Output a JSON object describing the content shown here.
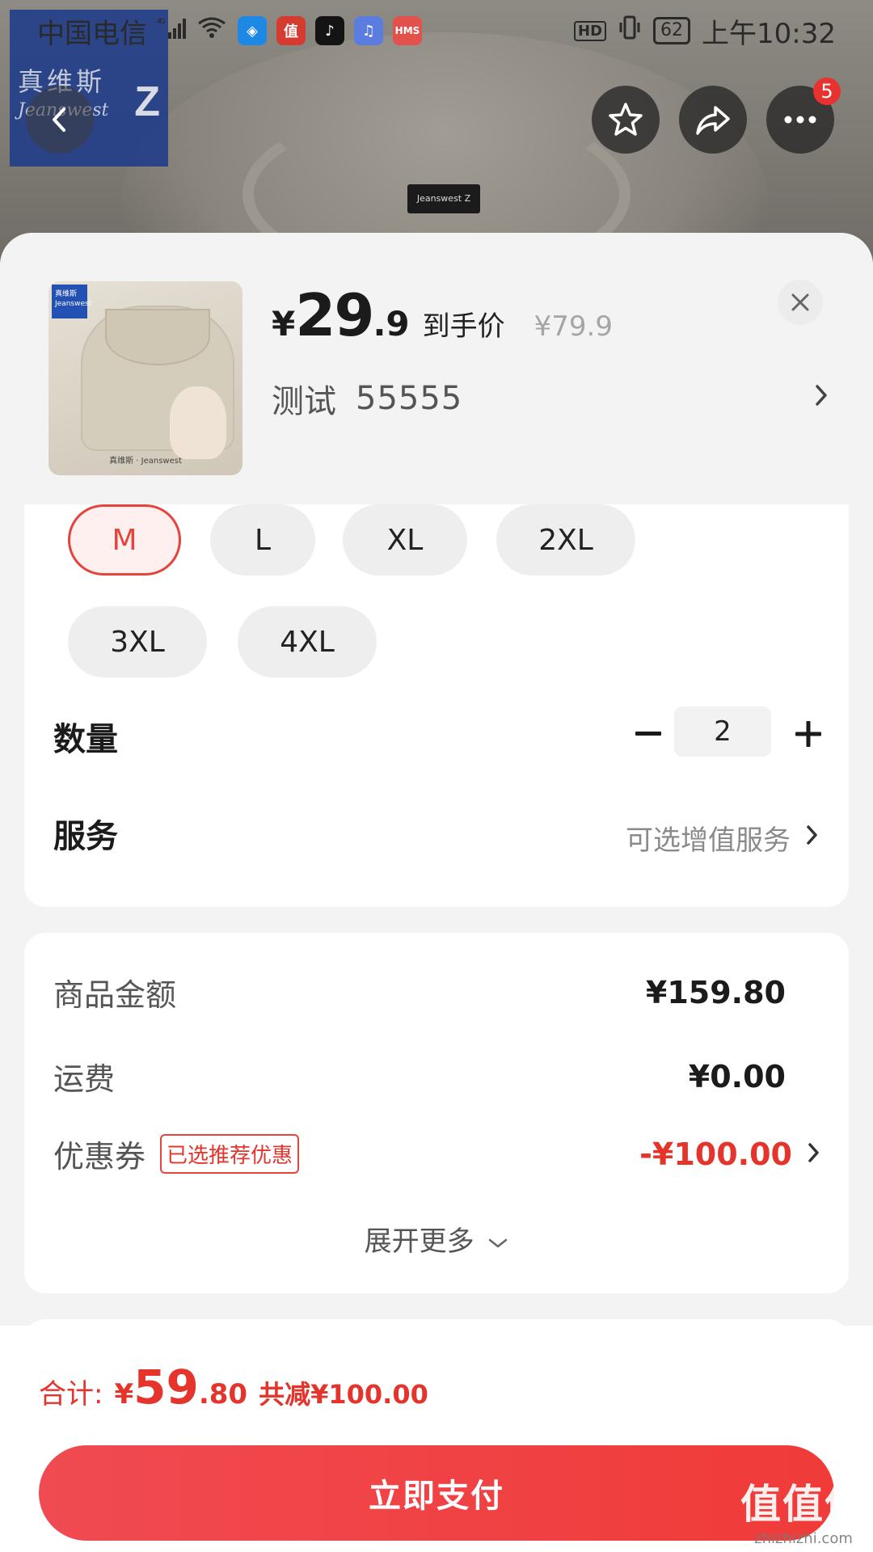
{
  "status_bar": {
    "carrier": "中国电信",
    "signal": "4G",
    "time": "上午10:32",
    "hd": "HD",
    "battery": "62",
    "apps": [
      {
        "name": "compass-app",
        "color": "#1e88e5",
        "glyph": "◈"
      },
      {
        "name": "zhi-app",
        "color": "#d63b2f",
        "glyph": "值"
      },
      {
        "name": "tiktok-app",
        "color": "#141414",
        "glyph": "♪"
      },
      {
        "name": "music-app",
        "color": "#5b7de0",
        "glyph": "♫"
      },
      {
        "name": "hms-app",
        "color": "#e2514c",
        "glyph": "HMS"
      }
    ]
  },
  "background": {
    "brand_cn": "真维斯",
    "brand_en": "Jeanswest",
    "brand_mark": "Z",
    "tag_text": "Jeanswest Z"
  },
  "nav": {
    "more_badge": "5"
  },
  "product": {
    "price_yen": "¥",
    "price_int": "29",
    "price_dec": ".9",
    "price_tag": "到手价",
    "original_price": "¥79.9",
    "spec_label": "测试",
    "spec_value": "55555",
    "thumb_logo": "真维斯 Jeanswest",
    "thumb_caption": "真维斯 · Jeanswest"
  },
  "sizes": [
    {
      "label": "M",
      "selected": true
    },
    {
      "label": "L",
      "selected": false
    },
    {
      "label": "XL",
      "selected": false
    },
    {
      "label": "2XL",
      "selected": false
    },
    {
      "label": "3XL",
      "selected": false
    },
    {
      "label": "4XL",
      "selected": false
    }
  ],
  "quantity": {
    "label": "数量",
    "value": "2",
    "minus": "−",
    "plus": "+"
  },
  "service": {
    "label": "服务",
    "hint": "可选增值服务"
  },
  "summary": {
    "goods_label": "商品金额",
    "goods_value": "¥159.80",
    "shipping_label": "运费",
    "shipping_value": "¥0.00",
    "coupon_label": "优惠券",
    "coupon_tag": "已选推荐优惠",
    "coupon_value": "-¥100.00",
    "expand_label": "展开更多"
  },
  "bottom": {
    "total_label": "合计:",
    "total_yen": "¥",
    "total_int": "59",
    "total_dec": ".80",
    "total_save": "共减¥100.00",
    "pay_label": "立即支付"
  },
  "watermark": {
    "logo": "值值值",
    "url": "zhizhizhi.com"
  },
  "colors": {
    "accent_red": "#e4342c",
    "pay_button": "#f03b38"
  }
}
